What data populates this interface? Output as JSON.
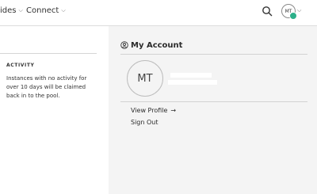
{
  "nav": {
    "items": [
      {
        "label": "ides",
        "icon": "chevron-down-icon"
      },
      {
        "label": "Connect",
        "icon": "chevron-down-icon"
      }
    ],
    "search_icon": "search-icon",
    "user_initials": "MT",
    "status_color": "#2db08a"
  },
  "left": {
    "heading": "ACTIVITY",
    "text": "Instances with no activity for over 10 days will be claimed back in to the pool."
  },
  "account": {
    "title": "My Account",
    "icon": "user-circle-icon",
    "initials": "MT",
    "view_profile_label": "View Profile",
    "view_profile_icon": "arrow-right-icon",
    "sign_out_label": "Sign Out"
  }
}
